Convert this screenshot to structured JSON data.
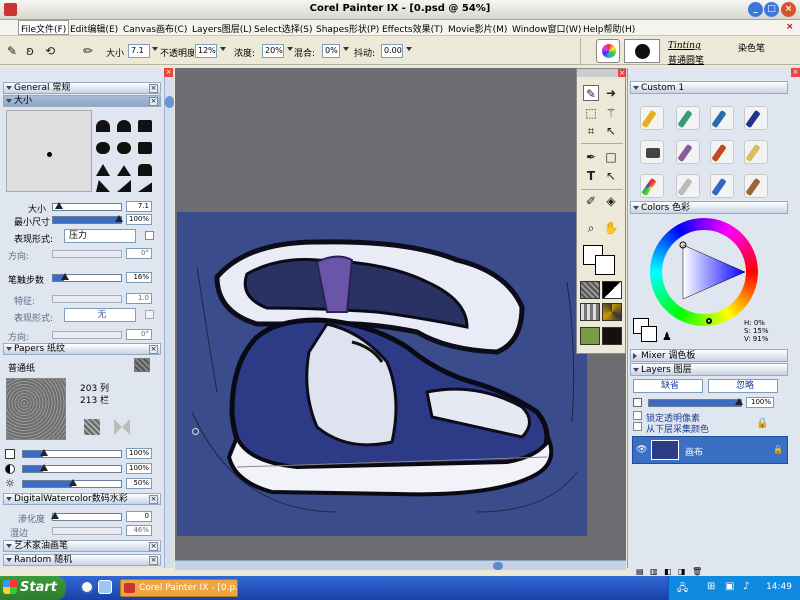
{
  "window": {
    "title": "Corel Painter IX - [0.psd @ 54%]"
  },
  "menu": [
    "File文件(F)",
    "Edit编辑(E)",
    "Canvas画布(C)",
    "Layers图层(L)",
    "Select选择(S)",
    "Shapes形状(P)",
    "Effects效果(T)",
    "Movie影片(M)",
    "Window窗口(W)",
    "Help帮助(H)"
  ],
  "propbar": {
    "size_label": "大小",
    "size_value": "7.1",
    "opacity_label": "不透明度",
    "opacity_value": "12%",
    "concentration_label": "浓度:",
    "concentration_value": "20%",
    "mix_label": "混合:",
    "mix_value": "0%",
    "jitter_label": "抖动:",
    "jitter_value": "0.00",
    "brush_category": "Tinting",
    "brush_category_cn": "染色笔",
    "brush_variant": "普通圆笔"
  },
  "left": {
    "general_title": "General 常规",
    "size_title": "大小",
    "size_label": "大小",
    "size_value": "7.1",
    "minsize_label": "最小尺寸",
    "minsize_value": "100%",
    "expression_label": "表现形式:",
    "expression_value": "压力",
    "direction_label": "方向:",
    "direction_value": "0°",
    "stroke_steps_label": "笔触步数",
    "stroke_steps_value": "16%",
    "feature_label": "特征:",
    "feature_value": "1.0",
    "expression2_label": "表现形式:",
    "expression2_value": "无",
    "direction2_label": "方向:",
    "direction2_value": "0°",
    "papers_title": "Papers 纸纹",
    "paper_name": "普通纸",
    "paper_cols": "203 列",
    "paper_rows": "213 栏",
    "paper_scale": "100%",
    "paper_contrast": "100%",
    "paper_brightness": "50%",
    "dw_title": "DigitalWatercolor数码水彩",
    "diffusion_label": "渗化度",
    "diffusion_value": "0",
    "wet_fringe_label": "湿边",
    "wet_fringe_value": "46%",
    "artist_oils_title": "艺术家油画笔",
    "random_title": "Random 随机"
  },
  "right": {
    "custom_title": "Custom 1",
    "colors_title": "Colors 色彩",
    "hsv_h": "H: 0%",
    "hsv_s": "S: 15%",
    "hsv_v": "V: 91%",
    "mixer_title": "Mixer 调色板",
    "layers_title": "Layers 图层",
    "composite_method": "缺省",
    "composite_depth": "忽略",
    "layer_opacity": "100%",
    "preserve_transparency": "锁定透明像素",
    "pick_up_color": "从下层采集颜色",
    "layer_name": "画布"
  },
  "taskbar": {
    "start": "Start",
    "app": "Corel Painter IX - [0.p...",
    "clock": "14:49"
  },
  "colors": {
    "canvas_bg": "#3a4c8b",
    "hue_accent": "#3d6bc2"
  }
}
